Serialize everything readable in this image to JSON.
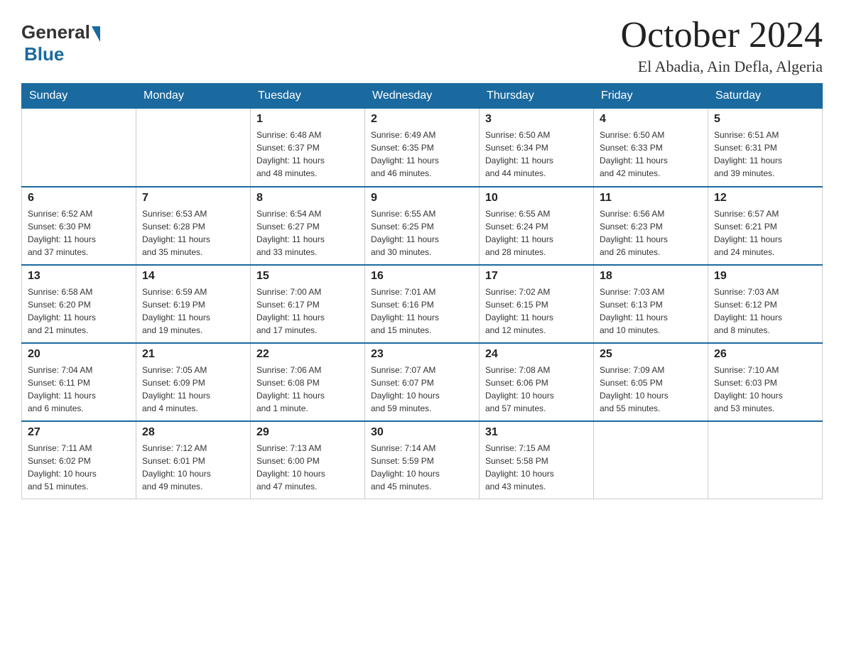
{
  "header": {
    "logo": {
      "text_general": "General",
      "text_blue": "Blue"
    },
    "title": "October 2024",
    "subtitle": "El Abadia, Ain Defla, Algeria"
  },
  "weekdays": [
    "Sunday",
    "Monday",
    "Tuesday",
    "Wednesday",
    "Thursday",
    "Friday",
    "Saturday"
  ],
  "weeks": [
    [
      {
        "day": "",
        "info": ""
      },
      {
        "day": "",
        "info": ""
      },
      {
        "day": "1",
        "info": "Sunrise: 6:48 AM\nSunset: 6:37 PM\nDaylight: 11 hours\nand 48 minutes."
      },
      {
        "day": "2",
        "info": "Sunrise: 6:49 AM\nSunset: 6:35 PM\nDaylight: 11 hours\nand 46 minutes."
      },
      {
        "day": "3",
        "info": "Sunrise: 6:50 AM\nSunset: 6:34 PM\nDaylight: 11 hours\nand 44 minutes."
      },
      {
        "day": "4",
        "info": "Sunrise: 6:50 AM\nSunset: 6:33 PM\nDaylight: 11 hours\nand 42 minutes."
      },
      {
        "day": "5",
        "info": "Sunrise: 6:51 AM\nSunset: 6:31 PM\nDaylight: 11 hours\nand 39 minutes."
      }
    ],
    [
      {
        "day": "6",
        "info": "Sunrise: 6:52 AM\nSunset: 6:30 PM\nDaylight: 11 hours\nand 37 minutes."
      },
      {
        "day": "7",
        "info": "Sunrise: 6:53 AM\nSunset: 6:28 PM\nDaylight: 11 hours\nand 35 minutes."
      },
      {
        "day": "8",
        "info": "Sunrise: 6:54 AM\nSunset: 6:27 PM\nDaylight: 11 hours\nand 33 minutes."
      },
      {
        "day": "9",
        "info": "Sunrise: 6:55 AM\nSunset: 6:25 PM\nDaylight: 11 hours\nand 30 minutes."
      },
      {
        "day": "10",
        "info": "Sunrise: 6:55 AM\nSunset: 6:24 PM\nDaylight: 11 hours\nand 28 minutes."
      },
      {
        "day": "11",
        "info": "Sunrise: 6:56 AM\nSunset: 6:23 PM\nDaylight: 11 hours\nand 26 minutes."
      },
      {
        "day": "12",
        "info": "Sunrise: 6:57 AM\nSunset: 6:21 PM\nDaylight: 11 hours\nand 24 minutes."
      }
    ],
    [
      {
        "day": "13",
        "info": "Sunrise: 6:58 AM\nSunset: 6:20 PM\nDaylight: 11 hours\nand 21 minutes."
      },
      {
        "day": "14",
        "info": "Sunrise: 6:59 AM\nSunset: 6:19 PM\nDaylight: 11 hours\nand 19 minutes."
      },
      {
        "day": "15",
        "info": "Sunrise: 7:00 AM\nSunset: 6:17 PM\nDaylight: 11 hours\nand 17 minutes."
      },
      {
        "day": "16",
        "info": "Sunrise: 7:01 AM\nSunset: 6:16 PM\nDaylight: 11 hours\nand 15 minutes."
      },
      {
        "day": "17",
        "info": "Sunrise: 7:02 AM\nSunset: 6:15 PM\nDaylight: 11 hours\nand 12 minutes."
      },
      {
        "day": "18",
        "info": "Sunrise: 7:03 AM\nSunset: 6:13 PM\nDaylight: 11 hours\nand 10 minutes."
      },
      {
        "day": "19",
        "info": "Sunrise: 7:03 AM\nSunset: 6:12 PM\nDaylight: 11 hours\nand 8 minutes."
      }
    ],
    [
      {
        "day": "20",
        "info": "Sunrise: 7:04 AM\nSunset: 6:11 PM\nDaylight: 11 hours\nand 6 minutes."
      },
      {
        "day": "21",
        "info": "Sunrise: 7:05 AM\nSunset: 6:09 PM\nDaylight: 11 hours\nand 4 minutes."
      },
      {
        "day": "22",
        "info": "Sunrise: 7:06 AM\nSunset: 6:08 PM\nDaylight: 11 hours\nand 1 minute."
      },
      {
        "day": "23",
        "info": "Sunrise: 7:07 AM\nSunset: 6:07 PM\nDaylight: 10 hours\nand 59 minutes."
      },
      {
        "day": "24",
        "info": "Sunrise: 7:08 AM\nSunset: 6:06 PM\nDaylight: 10 hours\nand 57 minutes."
      },
      {
        "day": "25",
        "info": "Sunrise: 7:09 AM\nSunset: 6:05 PM\nDaylight: 10 hours\nand 55 minutes."
      },
      {
        "day": "26",
        "info": "Sunrise: 7:10 AM\nSunset: 6:03 PM\nDaylight: 10 hours\nand 53 minutes."
      }
    ],
    [
      {
        "day": "27",
        "info": "Sunrise: 7:11 AM\nSunset: 6:02 PM\nDaylight: 10 hours\nand 51 minutes."
      },
      {
        "day": "28",
        "info": "Sunrise: 7:12 AM\nSunset: 6:01 PM\nDaylight: 10 hours\nand 49 minutes."
      },
      {
        "day": "29",
        "info": "Sunrise: 7:13 AM\nSunset: 6:00 PM\nDaylight: 10 hours\nand 47 minutes."
      },
      {
        "day": "30",
        "info": "Sunrise: 7:14 AM\nSunset: 5:59 PM\nDaylight: 10 hours\nand 45 minutes."
      },
      {
        "day": "31",
        "info": "Sunrise: 7:15 AM\nSunset: 5:58 PM\nDaylight: 10 hours\nand 43 minutes."
      },
      {
        "day": "",
        "info": ""
      },
      {
        "day": "",
        "info": ""
      }
    ]
  ]
}
